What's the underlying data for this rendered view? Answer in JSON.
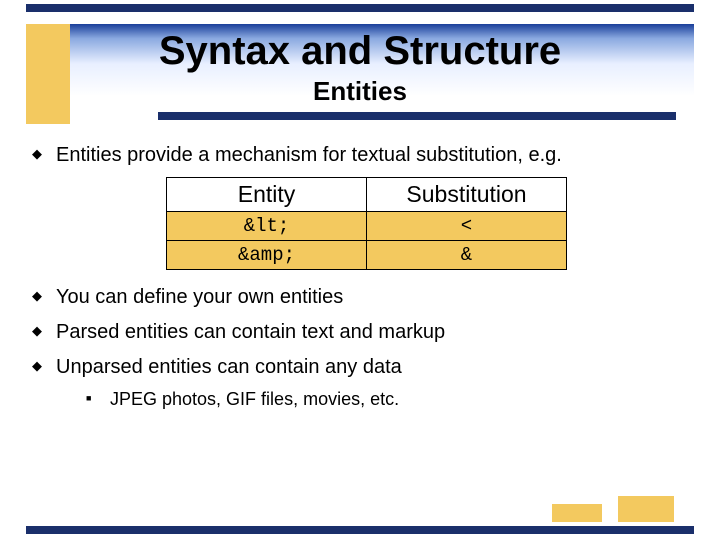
{
  "title": "Syntax and Structure",
  "subtitle": "Entities",
  "bullets": {
    "b1": "Entities provide a mechanism for textual substitution, e.g.",
    "b2": "You can define your own entities",
    "b3": "Parsed entities can contain text and markup",
    "b4": "Unparsed entities can contain any data",
    "b4_sub1": "JPEG photos, GIF files, movies, etc."
  },
  "table": {
    "h1": "Entity",
    "h2": "Substitution",
    "r1c1": "&lt;",
    "r1c2": "<",
    "r2c1": "&amp;",
    "r2c2": "&"
  }
}
